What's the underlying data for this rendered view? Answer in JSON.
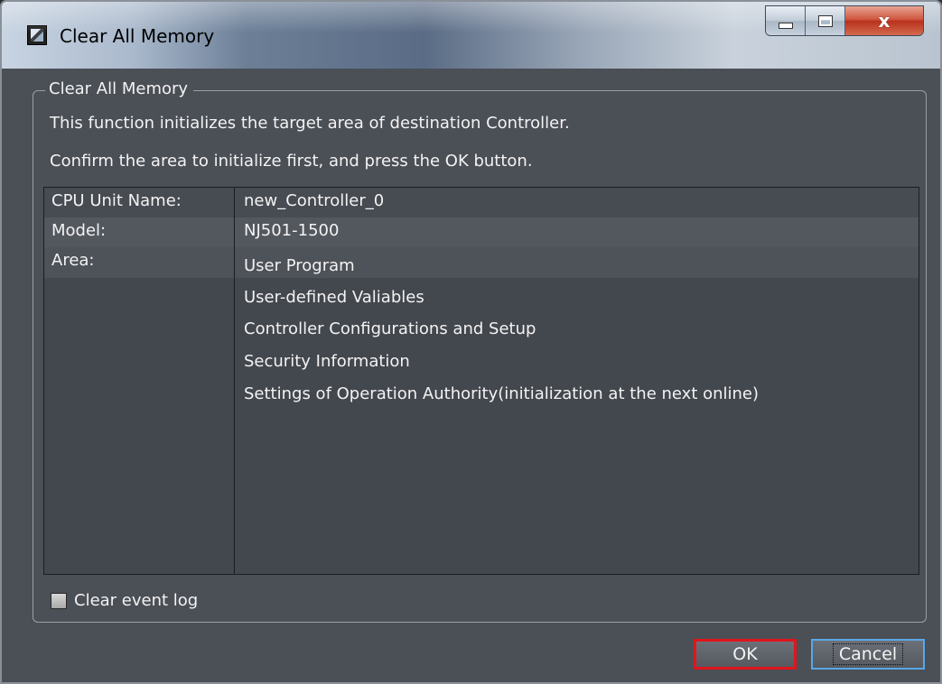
{
  "window": {
    "title": "Clear All Memory"
  },
  "caption": {
    "close_label": "x"
  },
  "group": {
    "legend": "Clear All Memory",
    "description_lines": [
      "This function initializes the target area of destination Controller.",
      "Confirm the area to initialize first, and press the OK button."
    ]
  },
  "info": {
    "cpu_unit_label": "CPU Unit Name:",
    "cpu_unit_value": "new_Controller_0",
    "model_label": "Model:",
    "model_value": "NJ501-1500",
    "area_label": "Area:",
    "areas": [
      "User Program",
      "User-defined Valiables",
      "Controller Configurations and Setup",
      "Security Information",
      "Settings of Operation Authority(initialization at the next online)"
    ]
  },
  "options": {
    "clear_event_log_label": "Clear event log",
    "clear_event_log_checked": false
  },
  "buttons": {
    "ok_label": "OK",
    "cancel_label": "Cancel"
  },
  "colors": {
    "dialog_background": "#4b4f56",
    "text": "#f3f3f3",
    "ok_highlight": "#e0151b",
    "cancel_focus": "#58a8e8",
    "close_button": "#c8452b"
  }
}
